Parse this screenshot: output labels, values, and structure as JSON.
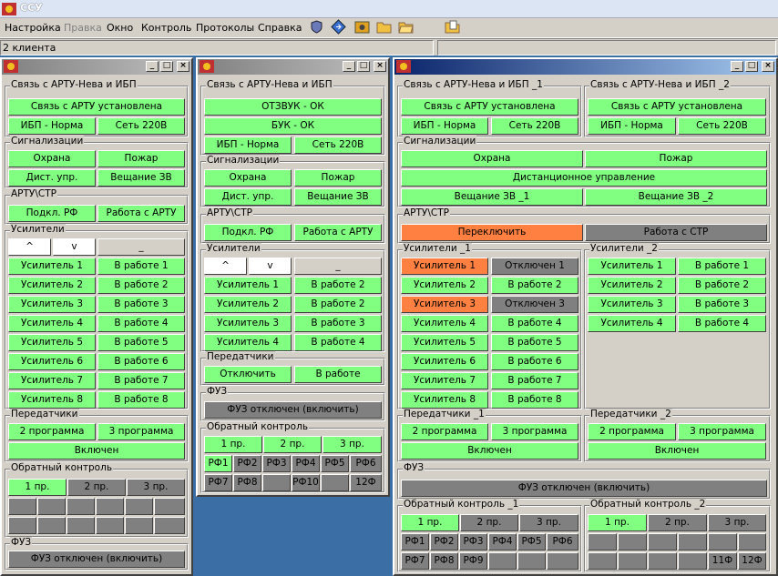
{
  "app": {
    "title": "ССУ",
    "status": "2 клиента",
    "brand_color": "#80ff80",
    "alarm_color": "#ff8040",
    "off_color": "#808080"
  },
  "menu": [
    "Настройка",
    "Правка",
    "Окно",
    "Контроль",
    "Протоколы",
    "Справка"
  ],
  "toolbar_icons": [
    "shield-icon",
    "diamond-icon",
    "settings-icon",
    "folder-icon",
    "folder-open-icon",
    "folder-doc-icon"
  ],
  "w": {
    "min": "_",
    "max": "□",
    "close": "×"
  },
  "c": {
    "g_link": "Связь с АРТУ-Нева и ИБП",
    "g_link1": "Связь с АРТУ-Нева и ИБП _1",
    "g_link2": "Связь с АРТУ-Нева и ИБП _2",
    "g_sig": "Сигнализации",
    "g_artu": "АРТУ\\СТР",
    "g_amp": "Усилители",
    "g_amp1": "Усилители _1",
    "g_amp2": "Усилители _2",
    "g_tx": "Передатчики",
    "g_tx1": "Передатчики _1",
    "g_tx2": "Передатчики _2",
    "g_fuz": "ФУЗ",
    "g_ret": "Обратный контроль",
    "g_ret1": "Обратный контроль _1",
    "g_ret2": "Обратный контроль _2",
    "link_ok": "Связь с АРТУ установлена",
    "ups": "ИБП - Норма",
    "grid": "Сеть 220В",
    "echo": "ОТЗВУК - ОК",
    "buk": "БУК - ОК",
    "guard": "Охрана",
    "fire": "Пожар",
    "remote": "Дист. упр.",
    "remote_full": "Дистанционное управление",
    "zv": "Вещание ЗВ",
    "zv1": "Вещание ЗВ _1",
    "zv2": "Вещание ЗВ _2",
    "conn_rf": "Подкл. РФ",
    "work_artu": "Работа с АРТУ",
    "switch": "Переключить",
    "work_str": "Работа с СТР",
    "up": "^",
    "down": "v",
    "dash": "_",
    "a1": "Усилитель 1",
    "a2": "Усилитель 2",
    "a3": "Усилитель 3",
    "a4": "Усилитель 4",
    "a5": "Усилитель 5",
    "a6": "Усилитель 6",
    "a7": "Усилитель 7",
    "a8": "Усилитель 8",
    "r1": "В работе 1",
    "r2": "В работе 2",
    "r3": "В работе 3",
    "r4": "В работе 4",
    "r5": "В работе 5",
    "r6": "В работе 6",
    "r7": "В работе 7",
    "r8": "В работе 8",
    "off1": "Отключен 1",
    "off3": "Отключен 3",
    "p2": "2 программа",
    "p3": "3 программа",
    "on": "Включен",
    "disable": "Отключить",
    "working": "В работе",
    "fuz_off": "ФУЗ отключен (включить)",
    "pr1": "1 пр.",
    "pr2": "2 пр.",
    "pr3": "3 пр.",
    "rf1": "РФ1",
    "rf2": "РФ2",
    "rf3": "РФ3",
    "rf4": "РФ4",
    "rf5": "РФ5",
    "rf6": "РФ6",
    "rf7": "РФ7",
    "rf8": "РФ8",
    "rf9": "РФ9",
    "rf10": "РФ10",
    "f11": "11Ф",
    "f12": "12Ф"
  }
}
